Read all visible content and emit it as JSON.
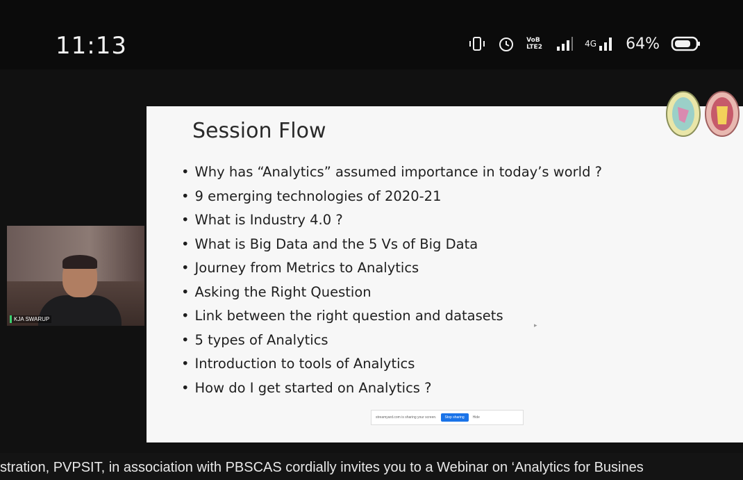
{
  "status_bar": {
    "time": "11:13",
    "icons": [
      "vibrate-icon",
      "alarm-icon",
      "volte-icon",
      "signal-icon",
      "4g-signal-icon",
      "battery-icon"
    ],
    "volte_text": "VoB LTE2",
    "network_text": "4G",
    "battery_text": "64%"
  },
  "slide": {
    "title": "Session Flow",
    "bullets": [
      "Why has  “Analytics” assumed importance in today’s world ?",
      "9 emerging technologies of 2020-21",
      "What is Industry 4.0 ?",
      "What is Big Data and the 5 Vs of Big Data",
      "Journey from Metrics to Analytics",
      "Asking the Right Question",
      "Link between the right question and datasets",
      "5 types of Analytics",
      "Introduction to tools of Analytics",
      "How do I get started on Analytics ?"
    ],
    "share_bar": {
      "message": "streamyard.com is sharing your screen.",
      "stop_label": "Stop sharing",
      "hide_label": "Hide"
    }
  },
  "speaker": {
    "name": "KJA SWARUP"
  },
  "ticker": {
    "text": "stration, PVPSIT, in association with PBSCAS cordially invites you to a Webinar on ‘Analytics for Busines"
  },
  "colors": {
    "background": "#101010",
    "slide_bg": "#f7f7f7",
    "share_button": "#1a73e8",
    "speaker_tag": "#3cd070"
  }
}
